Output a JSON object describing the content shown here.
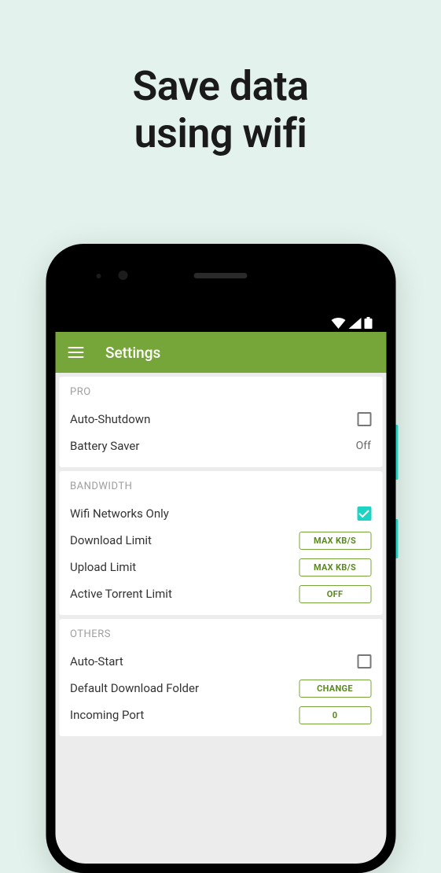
{
  "hero": {
    "line1": "Save data",
    "line2": "using wifi"
  },
  "app": {
    "title": "Settings"
  },
  "sections": {
    "pro": {
      "header": "PRO",
      "auto_shutdown": "Auto-Shutdown",
      "battery_saver": "Battery Saver",
      "battery_saver_value": "Off"
    },
    "bandwidth": {
      "header": "BANDWIDTH",
      "wifi_only": "Wifi Networks Only",
      "download_limit": "Download Limit",
      "download_limit_btn": "MAX KB/S",
      "upload_limit": "Upload Limit",
      "upload_limit_btn": "MAX KB/S",
      "active_torrent": "Active Torrent Limit",
      "active_torrent_btn": "OFF"
    },
    "others": {
      "header": "OTHERS",
      "auto_start": "Auto-Start",
      "default_folder": "Default Download Folder",
      "default_folder_btn": "CHANGE",
      "incoming_port": "Incoming Port",
      "incoming_port_btn": "0"
    }
  }
}
